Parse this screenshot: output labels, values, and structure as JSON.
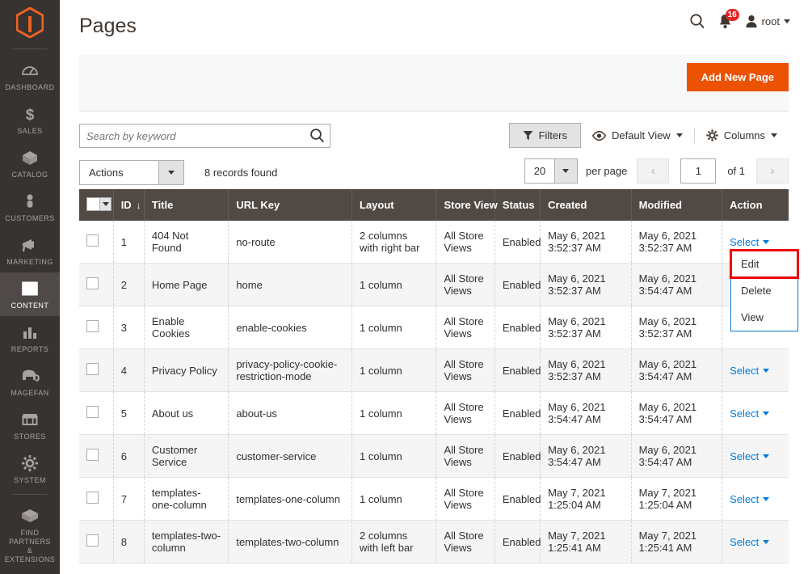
{
  "sidebar": {
    "logo_name": "magento-logo",
    "items": [
      {
        "label": "DASHBOARD",
        "icon": "dashboard-icon",
        "active": false
      },
      {
        "label": "SALES",
        "icon": "dollar-icon",
        "active": false
      },
      {
        "label": "CATALOG",
        "icon": "box-icon",
        "active": false
      },
      {
        "label": "CUSTOMERS",
        "icon": "person-icon",
        "active": false
      },
      {
        "label": "MARKETING",
        "icon": "megaphone-icon",
        "active": false
      },
      {
        "label": "CONTENT",
        "icon": "layout-icon",
        "active": true
      },
      {
        "label": "REPORTS",
        "icon": "bar-chart-icon",
        "active": false
      },
      {
        "label": "MAGEFAN",
        "icon": "elephant-icon",
        "active": false
      },
      {
        "label": "STORES",
        "icon": "store-icon",
        "active": false
      },
      {
        "label": "SYSTEM",
        "icon": "gear-icon",
        "active": false
      },
      {
        "label": "FIND PARTNERS\n& EXTENSIONS",
        "icon": "puzzle-icon",
        "active": false
      }
    ]
  },
  "header": {
    "title": "Pages",
    "search_icon": "search-icon",
    "notifications": {
      "icon": "bell-icon",
      "count": "16"
    },
    "user": {
      "icon": "user-icon",
      "name": "root"
    }
  },
  "action_bar": {
    "add_new_label": "Add New Page",
    "accent_color": "#eb5202"
  },
  "toolbar": {
    "search_placeholder": "Search by keyword",
    "search_value": "",
    "actions_label": "Actions",
    "records_found": "8 records found",
    "filters_label": "Filters",
    "view_label": "Default View",
    "columns_label": "Columns",
    "per_page_value": "20",
    "per_page_label": "per page",
    "page_number": "1",
    "of_total": "of 1"
  },
  "grid": {
    "columns": [
      {
        "key": "checkbox",
        "label": ""
      },
      {
        "key": "id",
        "label": "ID",
        "sorted": "desc",
        "sort_glyph": "↓"
      },
      {
        "key": "title",
        "label": "Title"
      },
      {
        "key": "url_key",
        "label": "URL Key"
      },
      {
        "key": "layout",
        "label": "Layout"
      },
      {
        "key": "store_view",
        "label": "Store View"
      },
      {
        "key": "status",
        "label": "Status"
      },
      {
        "key": "created",
        "label": "Created"
      },
      {
        "key": "modified",
        "label": "Modified"
      },
      {
        "key": "action",
        "label": "Action"
      }
    ],
    "action_label": "Select",
    "rows": [
      {
        "id": "1",
        "title": "404 Not Found",
        "url_key": "no-route",
        "layout": "2 columns with right bar",
        "store_view": "All Store Views",
        "status": "Enabled",
        "created": "May 6, 2021 3:52:37 AM",
        "modified": "May 6, 2021 3:52:37 AM"
      },
      {
        "id": "2",
        "title": "Home Page",
        "url_key": "home",
        "layout": "1 column",
        "store_view": "All Store Views",
        "status": "Enabled",
        "created": "May 6, 2021 3:52:37 AM",
        "modified": "May 6, 2021 3:54:47 AM"
      },
      {
        "id": "3",
        "title": "Enable Cookies",
        "url_key": "enable-cookies",
        "layout": "1 column",
        "store_view": "All Store Views",
        "status": "Enabled",
        "created": "May 6, 2021 3:52:37 AM",
        "modified": "May 6, 2021 3:52:37 AM"
      },
      {
        "id": "4",
        "title": "Privacy Policy",
        "url_key": "privacy-policy-cookie-restriction-mode",
        "layout": "1 column",
        "store_view": "All Store Views",
        "status": "Enabled",
        "created": "May 6, 2021 3:52:37 AM",
        "modified": "May 6, 2021 3:54:47 AM"
      },
      {
        "id": "5",
        "title": "About us",
        "url_key": "about-us",
        "layout": "1 column",
        "store_view": "All Store Views",
        "status": "Enabled",
        "created": "May 6, 2021 3:54:47 AM",
        "modified": "May 6, 2021 3:54:47 AM"
      },
      {
        "id": "6",
        "title": "Customer Service",
        "url_key": "customer-service",
        "layout": "1 column",
        "store_view": "All Store Views",
        "status": "Enabled",
        "created": "May 6, 2021 3:54:47 AM",
        "modified": "May 6, 2021 3:54:47 AM"
      },
      {
        "id": "7",
        "title": "templates-one-column",
        "url_key": "templates-one-column",
        "layout": "1 column",
        "store_view": "All Store Views",
        "status": "Enabled",
        "created": "May 7, 2021 1:25:04 AM",
        "modified": "May 7, 2021 1:25:04 AM"
      },
      {
        "id": "8",
        "title": "templates-two-column",
        "url_key": "templates-two-column",
        "layout": "2 columns with left bar",
        "store_view": "All Store Views",
        "status": "Enabled",
        "created": "May 7, 2021 1:25:41 AM",
        "modified": "May 7, 2021 1:25:41 AM"
      }
    ]
  },
  "action_dropdown": {
    "open_for_row_id": "2",
    "items": [
      {
        "label": "Edit",
        "highlighted": true
      },
      {
        "label": "Delete",
        "highlighted": false
      },
      {
        "label": "View",
        "highlighted": false
      }
    ],
    "highlight_color": "#ee0000",
    "border_color": "#007bdb"
  }
}
